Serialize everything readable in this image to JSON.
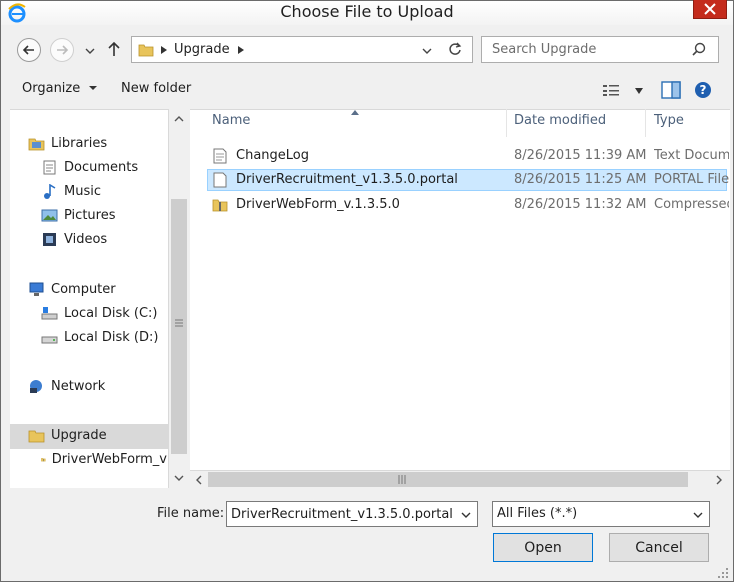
{
  "window": {
    "title": "Choose File to Upload"
  },
  "address": {
    "path_segment": "Upgrade"
  },
  "search": {
    "placeholder": "Search Upgrade"
  },
  "toolbar": {
    "organize": "Organize",
    "new_folder": "New folder"
  },
  "nav": {
    "libraries": "Libraries",
    "documents": "Documents",
    "music": "Music",
    "pictures": "Pictures",
    "videos": "Videos",
    "computer": "Computer",
    "local_c": "Local Disk (C:)",
    "local_d": "Local Disk (D:)",
    "network": "Network",
    "upgrade": "Upgrade",
    "driverwebform": "DriverWebForm_v"
  },
  "columns": {
    "name": "Name",
    "date": "Date modified",
    "type": "Type"
  },
  "files": [
    {
      "name": "ChangeLog",
      "date": "8/26/2015 11:39 AM",
      "type": "Text Document",
      "icon": "text-file-icon"
    },
    {
      "name": "DriverRecruitment_v1.3.5.0.portal",
      "date": "8/26/2015 11:25 AM",
      "type": "PORTAL File",
      "icon": "blank-file-icon"
    },
    {
      "name": "DriverWebForm_v.1.3.5.0",
      "date": "8/26/2015 11:32 AM",
      "type": "Compressed",
      "icon": "zip-folder-icon"
    }
  ],
  "bottom": {
    "file_name_label": "File name:",
    "file_name_value": "DriverRecruitment_v1.3.5.0.portal",
    "file_type_value": "All Files (*.*)",
    "open": "Open",
    "cancel": "Cancel"
  }
}
